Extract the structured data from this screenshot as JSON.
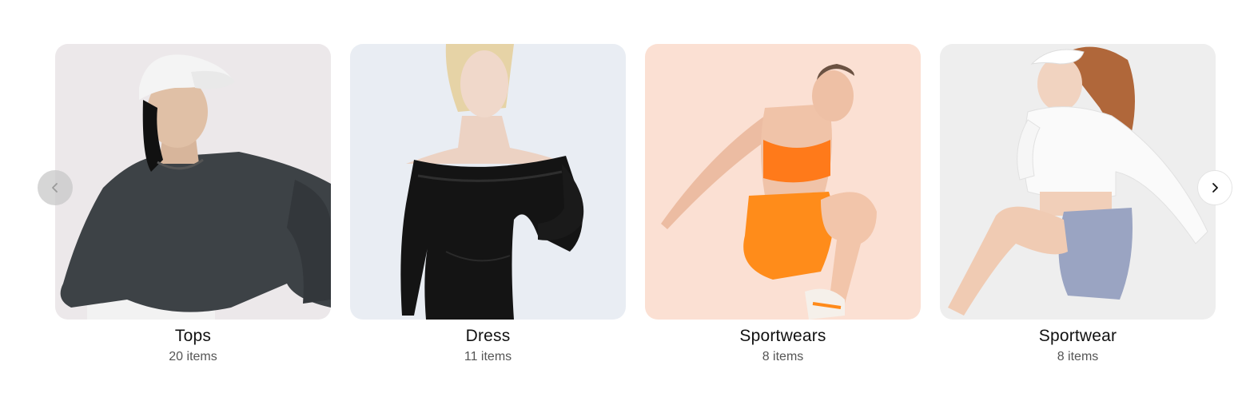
{
  "carousel": {
    "prev_icon": "chevron-left-icon",
    "next_icon": "chevron-right-icon",
    "cards": [
      {
        "title": "Tops",
        "count": "20 items",
        "image": "model-in-charcoal-sweatshirt-and-white-cap",
        "bg": "#ece8ea"
      },
      {
        "title": "Dress",
        "count": "11 items",
        "image": "model-in-black-velvet-off-shoulder-dress",
        "bg": "#e9edf3"
      },
      {
        "title": "Sportwears",
        "count": "8 items",
        "image": "model-in-orange-sports-bra-and-shorts",
        "bg": "#fbe0d3"
      },
      {
        "title": "Sportwear",
        "count": "8 items",
        "image": "model-in-white-crop-top-and-blue-shorts",
        "bg": "#eeeeee"
      }
    ]
  }
}
